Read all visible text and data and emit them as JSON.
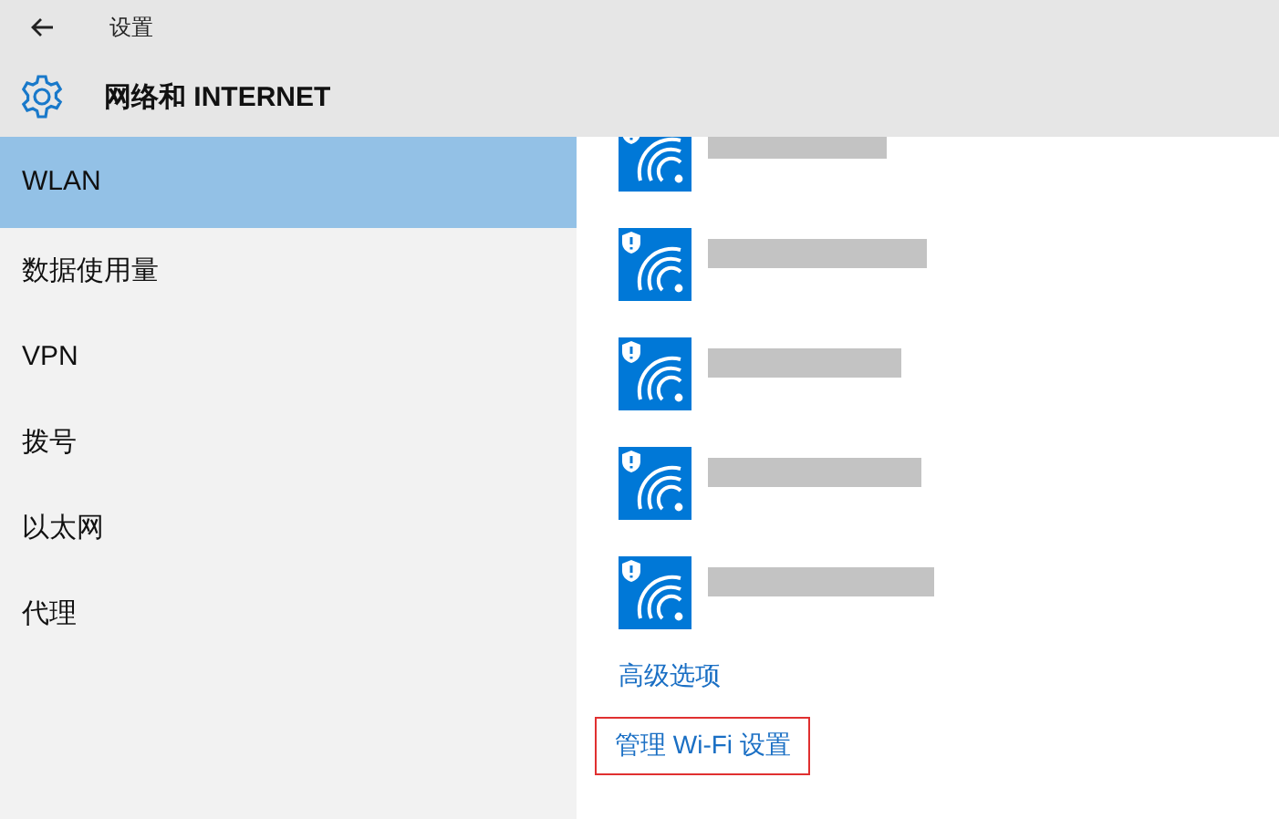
{
  "window": {
    "title": "设置"
  },
  "header": {
    "title": "网络和 INTERNET"
  },
  "sidebar": {
    "items": [
      {
        "label": "WLAN",
        "selected": true
      },
      {
        "label": "数据使用量",
        "selected": false
      },
      {
        "label": "VPN",
        "selected": false
      },
      {
        "label": "拨号",
        "selected": false
      },
      {
        "label": "以太网",
        "selected": false
      },
      {
        "label": "代理",
        "selected": false
      }
    ]
  },
  "networks": [
    {
      "secured": true
    },
    {
      "secured": true
    },
    {
      "secured": true
    },
    {
      "secured": true
    },
    {
      "secured": true
    }
  ],
  "links": [
    {
      "label": "高级选项",
      "highlighted": false
    },
    {
      "label": "管理 Wi-Fi 设置",
      "highlighted": true
    }
  ]
}
